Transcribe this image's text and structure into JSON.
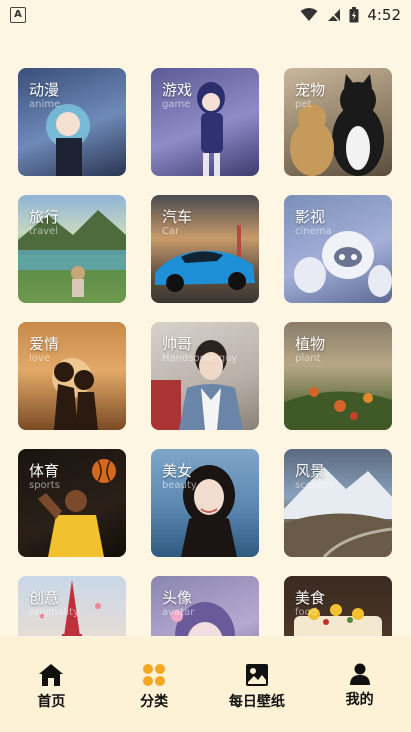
{
  "status_bar": {
    "time": "4:52",
    "left_badge": "A"
  },
  "categories": [
    {
      "title": "动漫",
      "subtitle": "anime"
    },
    {
      "title": "游戏",
      "subtitle": "game"
    },
    {
      "title": "宠物",
      "subtitle": "pet"
    },
    {
      "title": "旅行",
      "subtitle": "travel"
    },
    {
      "title": "汽车",
      "subtitle": "Car"
    },
    {
      "title": "影视",
      "subtitle": "cinema"
    },
    {
      "title": "爱情",
      "subtitle": "love"
    },
    {
      "title": "帅哥",
      "subtitle": "Handsome guy"
    },
    {
      "title": "植物",
      "subtitle": "plant"
    },
    {
      "title": "体育",
      "subtitle": "sports"
    },
    {
      "title": "美女",
      "subtitle": "beauty"
    },
    {
      "title": "风景",
      "subtitle": "scenery"
    },
    {
      "title": "创意",
      "subtitle": "originality"
    },
    {
      "title": "头像",
      "subtitle": "avatar"
    },
    {
      "title": "美食",
      "subtitle": "food"
    }
  ],
  "bottom_nav": [
    {
      "label": "首页",
      "icon": "home-icon"
    },
    {
      "label": "分类",
      "icon": "category-icon",
      "active": true,
      "active_color": "#f5a623"
    },
    {
      "label": "每日壁纸",
      "icon": "wallpaper-icon"
    },
    {
      "label": "我的",
      "icon": "profile-icon"
    }
  ]
}
